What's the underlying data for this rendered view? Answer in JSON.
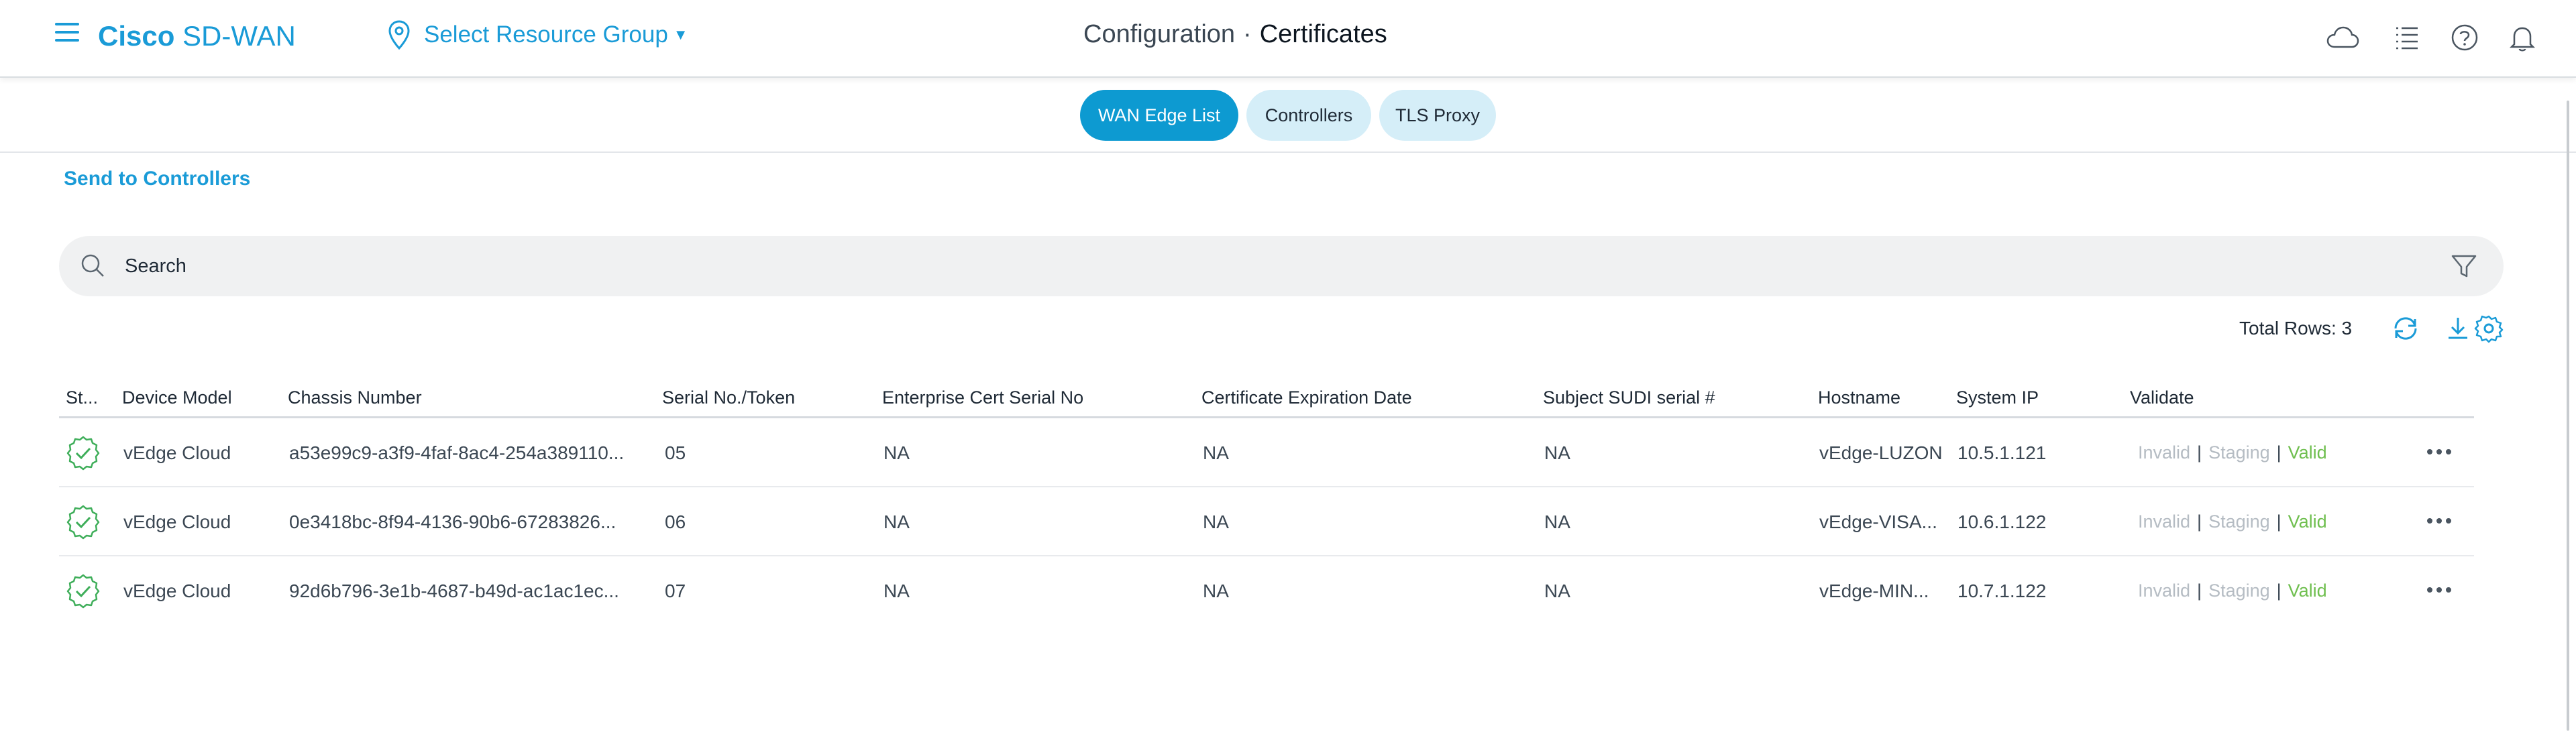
{
  "header": {
    "brand_bold": "Cisco",
    "brand_rest": "SD-WAN",
    "resource_group": "Select Resource Group",
    "breadcrumb_parent": "Configuration",
    "breadcrumb_sep": "·",
    "breadcrumb_current": "Certificates",
    "icons": [
      "cloud-icon",
      "list-icon",
      "help-icon",
      "bell-icon"
    ]
  },
  "tabs": [
    {
      "label": "WAN Edge List",
      "active": true
    },
    {
      "label": "Controllers",
      "active": false
    },
    {
      "label": "TLS Proxy",
      "active": false
    }
  ],
  "actions": {
    "send_label": "Send to Controllers"
  },
  "search": {
    "placeholder": "Search"
  },
  "toolbar": {
    "total_rows": "Total Rows: 3"
  },
  "table": {
    "columns": [
      "St...",
      "Device Model",
      "Chassis Number",
      "Serial No./Token",
      "Enterprise Cert Serial No",
      "Certificate Expiration Date",
      "Subject SUDI serial #",
      "Hostname",
      "System IP",
      "Validate"
    ],
    "rows": [
      {
        "model": "vEdge Cloud",
        "chassis": "a53e99c9-a3f9-4faf-8ac4-254a389110...",
        "serial": "05",
        "ent_cert": "NA",
        "expiry": "NA",
        "sudi": "NA",
        "hostname": "vEdge-LUZON",
        "system_ip": "10.5.1.121"
      },
      {
        "model": "vEdge Cloud",
        "chassis": "0e3418bc-8f94-4136-90b6-67283826...",
        "serial": "06",
        "ent_cert": "NA",
        "expiry": "NA",
        "sudi": "NA",
        "hostname": "vEdge-VISA...",
        "system_ip": "10.6.1.122"
      },
      {
        "model": "vEdge Cloud",
        "chassis": "92d6b796-3e1b-4687-b49d-ac1ac1ec...",
        "serial": "07",
        "ent_cert": "NA",
        "expiry": "NA",
        "sudi": "NA",
        "hostname": "vEdge-MIN...",
        "system_ip": "10.7.1.122"
      }
    ],
    "validate": {
      "invalid": "Invalid",
      "staging": "Staging",
      "valid": "Valid",
      "sep": "|"
    }
  },
  "colors": {
    "accent": "#1a9bd7",
    "valid": "#6fbf4f",
    "status_ok": "#3fae5a"
  }
}
